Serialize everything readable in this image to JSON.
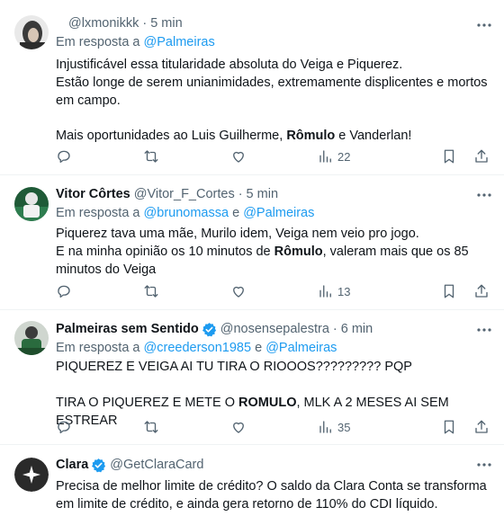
{
  "tweets": [
    {
      "handle": "@lxmonikkk",
      "time": "5 min",
      "reply_prefix": "Em resposta a",
      "reply_to": [
        "@Palmeiras"
      ],
      "body": [
        [
          {
            "t": "Injustificável essa titularidade absoluta do Veiga e Piquerez."
          }
        ],
        [
          {
            "t": "Estão longe de serem unianimidades, extremamente displicentes e mortos em campo."
          }
        ],
        [],
        [
          {
            "t": "Mais oportunidades ao Luis Guilherme, "
          },
          {
            "t": "Rômulo",
            "b": true
          },
          {
            "t": " e Vanderlan!"
          }
        ]
      ],
      "views": "22"
    },
    {
      "name": "Vitor Côrtes",
      "handle": "@Vitor_F_Cortes",
      "time": "5 min",
      "reply_prefix": "Em resposta a",
      "reply_to": [
        "@brunomassa",
        "@Palmeiras"
      ],
      "reply_sep": "e",
      "body": [
        [
          {
            "t": "Piquerez tava uma mãe, Murilo idem, Veiga nem veio pro jogo."
          }
        ],
        [
          {
            "t": "E na minha opinião os 10 minutos de "
          },
          {
            "t": "Rômulo",
            "b": true
          },
          {
            "t": ", valeram mais que os 85 minutos do Veiga"
          }
        ]
      ],
      "views": "13"
    },
    {
      "name": "Palmeiras sem Sentido",
      "handle": "@nosensepalestra",
      "time": "6 min",
      "reply_prefix": "Em resposta a",
      "reply_to": [
        "@creederson1985",
        "@Palmeiras"
      ],
      "reply_sep": "e",
      "body": [
        [
          {
            "t": "PIQUEREZ E VEIGA AI TU TIRA O RIOOOS????????? PQP"
          }
        ],
        [],
        [
          {
            "t": "TIRA O PIQUEREZ E METE O "
          },
          {
            "t": "ROMULO",
            "b": true
          },
          {
            "t": ", MLK A 2 MESES AI SEM ESTREAR"
          }
        ]
      ],
      "views": "35"
    },
    {
      "name": "Clara",
      "handle": "@GetClaraCard",
      "body": [
        [
          {
            "t": "Precisa de melhor limite de crédito? O saldo da Clara Conta  se transforma em limite de crédito, e ainda gera retorno de 110% do CDI líquido."
          }
        ]
      ]
    }
  ],
  "colors": {
    "accent": "#1d9bf0",
    "muted": "#536471",
    "text": "#0f1419",
    "verified": "#1d9bf0",
    "divider": "#eff3f4"
  },
  "icons": [
    "reply-icon",
    "retweet-icon",
    "like-icon",
    "views-icon",
    "bookmark-icon",
    "share-icon",
    "more-icon",
    "verified-icon"
  ]
}
